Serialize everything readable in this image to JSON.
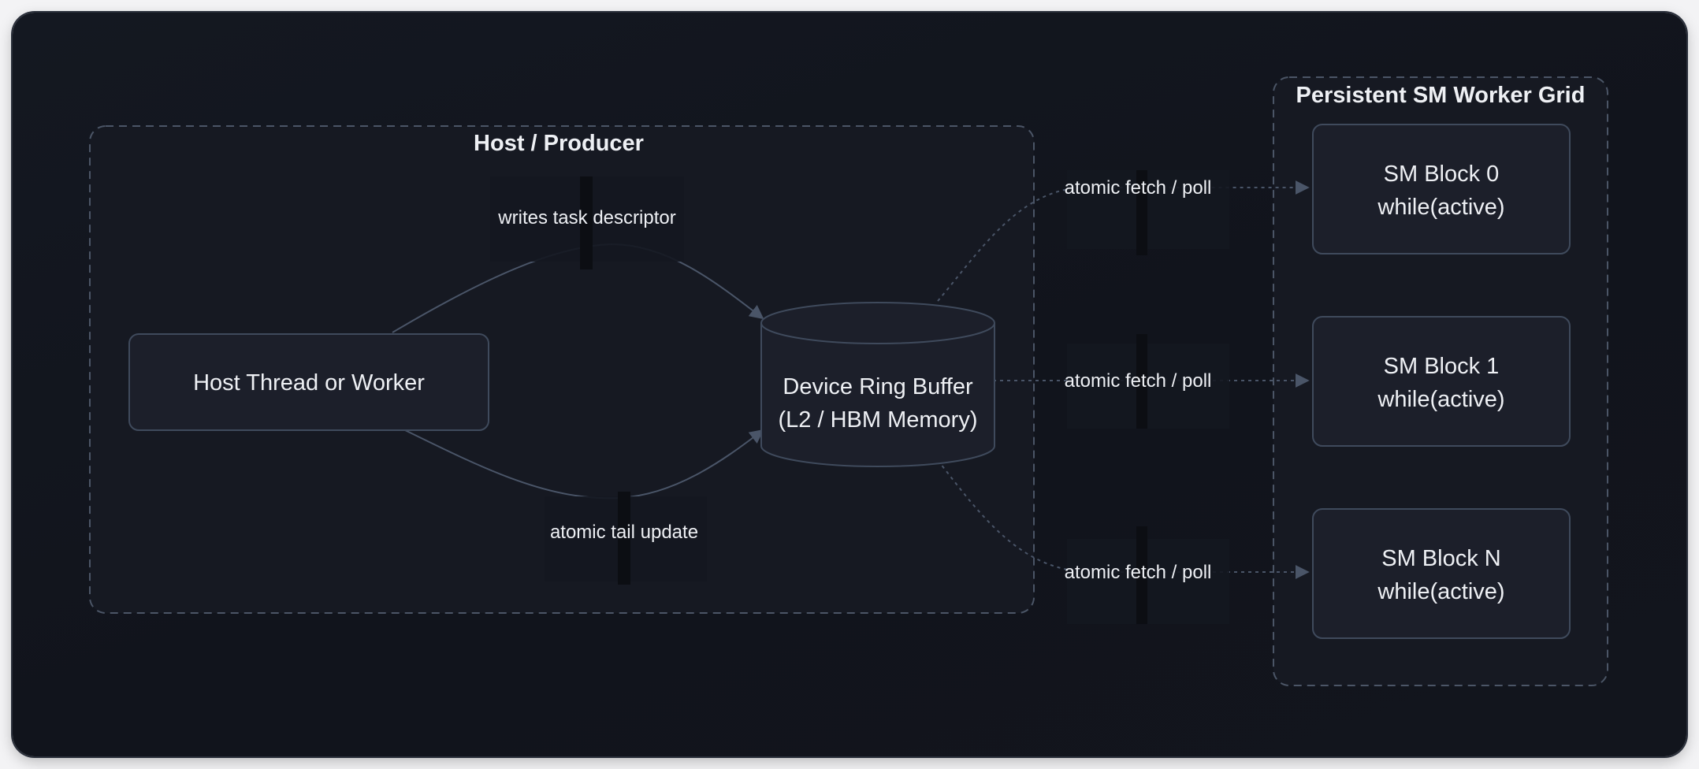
{
  "clusters": {
    "host": {
      "title": "Host / Producer"
    },
    "grid": {
      "title": "Persistent SM Worker Grid"
    }
  },
  "nodes": {
    "host_thread": {
      "label": "Host Thread or Worker"
    },
    "ring_buffer": {
      "line1": "Device Ring Buffer",
      "line2": "(L2 / HBM Memory)"
    },
    "sm_block_0": {
      "line1": "SM Block 0",
      "line2": "while(active)"
    },
    "sm_block_1": {
      "line1": "SM Block 1",
      "line2": "while(active)"
    },
    "sm_block_n": {
      "line1": "SM Block N",
      "line2": "while(active)"
    }
  },
  "edges": {
    "writes": {
      "label": "writes task descriptor"
    },
    "tail": {
      "label": "atomic tail update"
    },
    "fetch_0": {
      "label": "atomic fetch / poll"
    },
    "fetch_1": {
      "label": "atomic fetch / poll"
    },
    "fetch_n": {
      "label": "atomic fetch / poll"
    }
  },
  "colors": {
    "background": "#12151d",
    "cluster_fill": "#161922",
    "cluster_border": "#4b5566",
    "node_fill": "#1c1f2a",
    "node_border": "#3f4a5c",
    "edge": "#4a5568",
    "text": "#eef0f4"
  }
}
